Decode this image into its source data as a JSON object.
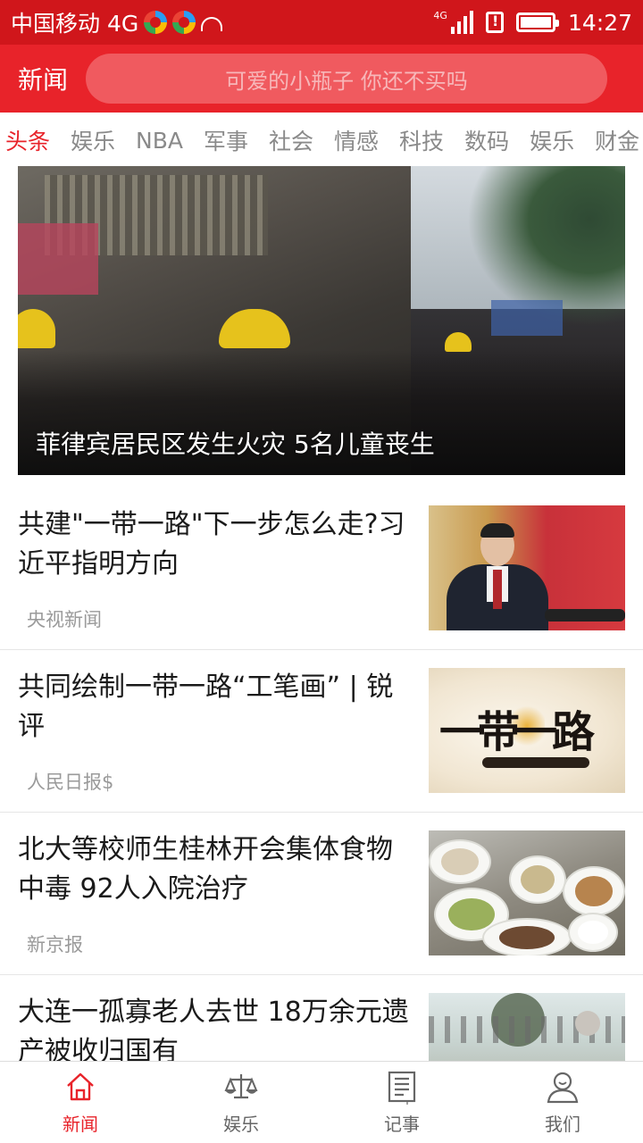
{
  "status_bar": {
    "carrier": "中国移动 4G",
    "network_label": "4G",
    "time": "14:27"
  },
  "header": {
    "title": "新闻",
    "search_placeholder": "可爱的小瓶子 你还不买吗"
  },
  "tabs": [
    "头条",
    "娱乐",
    "NBA",
    "军事",
    "社会",
    "情感",
    "科技",
    "数码",
    "娱乐",
    "财金"
  ],
  "active_tab_index": 0,
  "hero": {
    "caption": "菲律宾居民区发生火灾 5名儿童丧生"
  },
  "news": [
    {
      "title": "共建\"一带一路\"下一步怎么走?习近平指明方向",
      "source": "央视新闻"
    },
    {
      "title": "共同绘制一带一路“工笔画” | 锐评",
      "source": "人民日报$"
    },
    {
      "title": "北大等校师生桂林开会集体食物中毒 92人入院治疗",
      "source": "新京报"
    },
    {
      "title": "大连一孤寡老人去世 18万余元遗产被收归国有",
      "source": ""
    }
  ],
  "thumb_texts": {
    "belt_and_road": "一带一路"
  },
  "bottom_nav": [
    {
      "label": "新闻",
      "icon": "home-icon",
      "active": true
    },
    {
      "label": "娱乐",
      "icon": "scale-icon",
      "active": false
    },
    {
      "label": "记事",
      "icon": "notebook-icon",
      "active": false
    },
    {
      "label": "我们",
      "icon": "user-icon",
      "active": false
    }
  ],
  "colors": {
    "accent": "#e8232a",
    "status_bar": "#d0161b",
    "inactive_text": "#8a8a8a",
    "source_text": "#9a9a9a"
  }
}
